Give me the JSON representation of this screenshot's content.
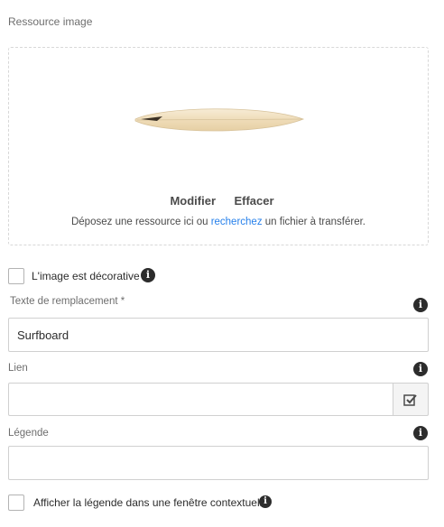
{
  "asset": {
    "section_label": "Ressource image",
    "actions": {
      "modify": "Modifier",
      "clear": "Effacer"
    },
    "drop_hint": {
      "before": "Déposez une ressource ici ou ",
      "link": "recherchez",
      "after": " un fichier à transférer."
    }
  },
  "decorative": {
    "label": "L'image est décorative",
    "checked": false,
    "info_icon": "info-icon"
  },
  "alt_text": {
    "label": "Texte de remplacement *",
    "value": "Surfboard",
    "info_icon": "info-icon"
  },
  "link": {
    "label": "Lien",
    "value": "",
    "picker_icon": "path-picker-icon",
    "info_icon": "info-icon"
  },
  "caption": {
    "label": "Légende",
    "value": "",
    "info_icon": "info-icon"
  },
  "caption_popup": {
    "label": "Afficher la légende dans une fenêtre contextuelle",
    "checked": false,
    "info_icon": "info-icon"
  },
  "colors": {
    "link": "#2680eb",
    "border": "#d0d0d0",
    "text": "#2c2c2c"
  }
}
